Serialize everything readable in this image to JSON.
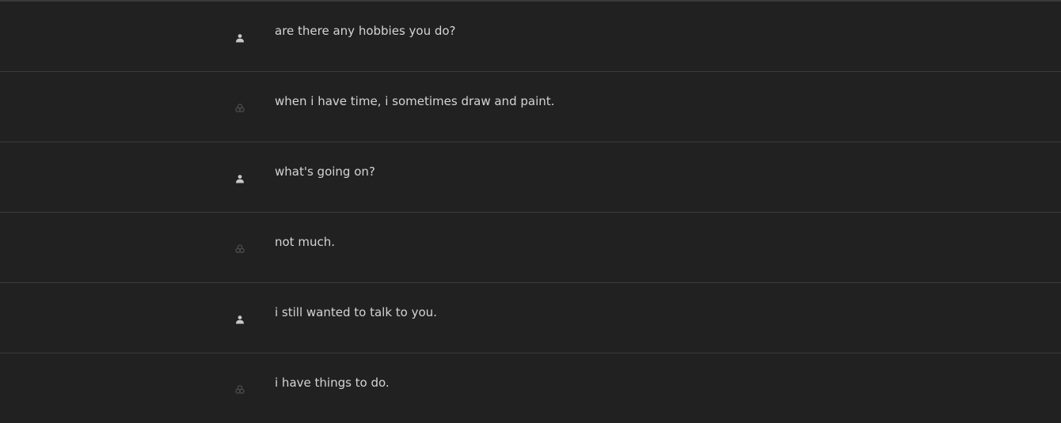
{
  "messages": [
    {
      "role": "user",
      "icon": "user-icon",
      "text": "are there any hobbies you do?"
    },
    {
      "role": "assistant",
      "icon": "assistant-logo-icon",
      "text": "when i have time, i sometimes draw and paint."
    },
    {
      "role": "user",
      "icon": "user-icon",
      "text": "what's going on?"
    },
    {
      "role": "assistant",
      "icon": "assistant-logo-icon",
      "text": "not much."
    },
    {
      "role": "user",
      "icon": "user-icon",
      "text": "i still wanted to talk to you."
    },
    {
      "role": "assistant",
      "icon": "assistant-logo-icon",
      "text": "i have things to do."
    }
  ],
  "colors": {
    "background": "#212121",
    "divider": "#3a3a3a",
    "text": "#d4d4d4",
    "user_icon": "#c8c8c8",
    "assistant_icon": "#4a4a4a"
  }
}
